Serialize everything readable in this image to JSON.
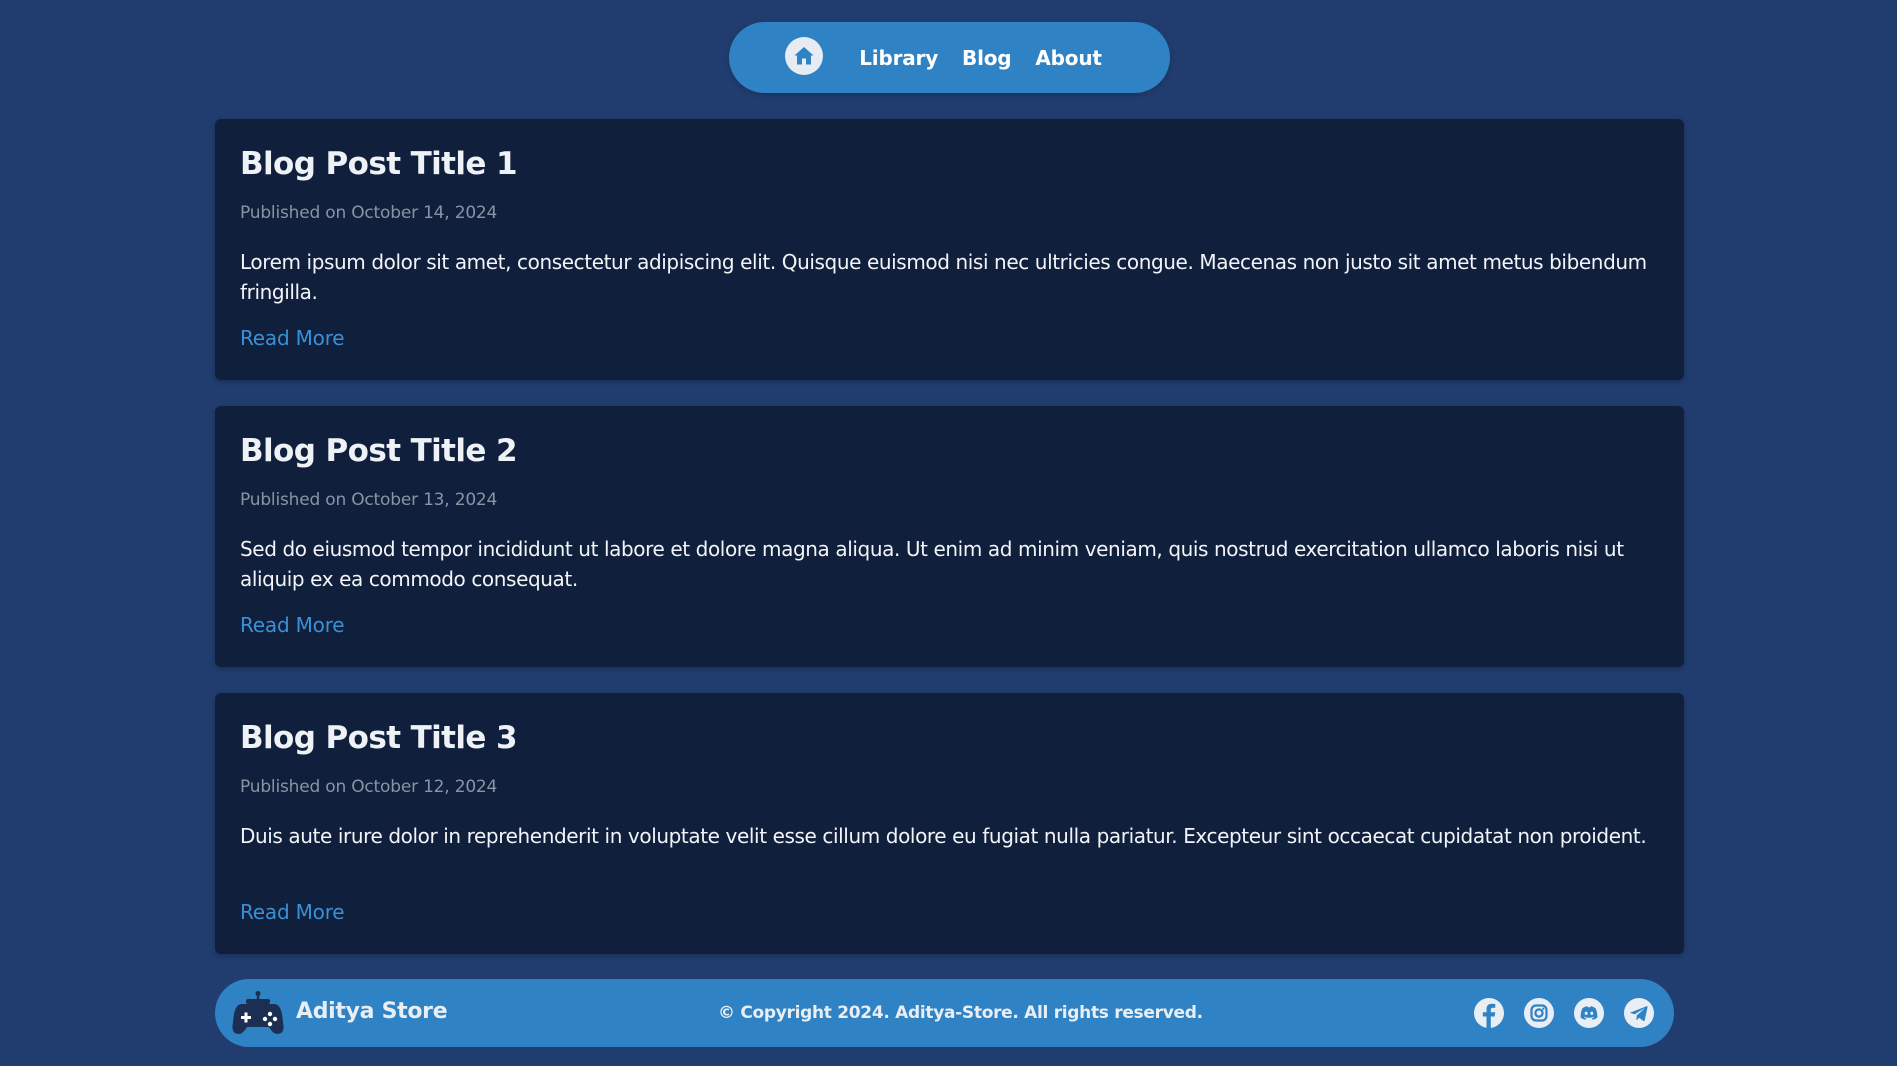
{
  "nav": {
    "home_icon": "home-icon",
    "links": [
      {
        "label": "Library"
      },
      {
        "label": "Blog"
      },
      {
        "label": "About"
      }
    ]
  },
  "posts": [
    {
      "title": "Blog Post Title 1",
      "date": "Published on October 14, 2024",
      "excerpt": "Lorem ipsum dolor sit amet, consectetur adipiscing elit. Quisque euismod nisi nec ultricies congue. Maecenas non justo sit amet metus bibendum fringilla.",
      "link_label": "Read More"
    },
    {
      "title": "Blog Post Title 2",
      "date": "Published on October 13, 2024",
      "excerpt": "Sed do eiusmod tempor incididunt ut labore et dolore magna aliqua. Ut enim ad minim veniam, quis nostrud exercitation ullamco laboris nisi ut aliquip ex ea commodo consequat.",
      "link_label": "Read More"
    },
    {
      "title": "Blog Post Title 3",
      "date": "Published on October 12, 2024",
      "excerpt": "Duis aute irure dolor in reprehenderit in voluptate velit esse cillum dolore eu fugiat nulla pariatur. Excepteur sint occaecat cupidatat non proident.",
      "link_label": "Read More"
    }
  ],
  "footer": {
    "logo_icon": "gamepad-icon",
    "brand": "Aditya Store",
    "copyright": "© Copyright 2024. Aditya-Store. All rights reserved.",
    "social_icons": [
      "facebook-icon",
      "instagram-icon",
      "discord-icon",
      "telegram-icon"
    ]
  },
  "colors": {
    "page_background": "#213d6f",
    "nav_background": "#2f82c4",
    "card_background": "#10203c",
    "link_color": "#3b8fd6",
    "date_color": "#8a93a3"
  }
}
